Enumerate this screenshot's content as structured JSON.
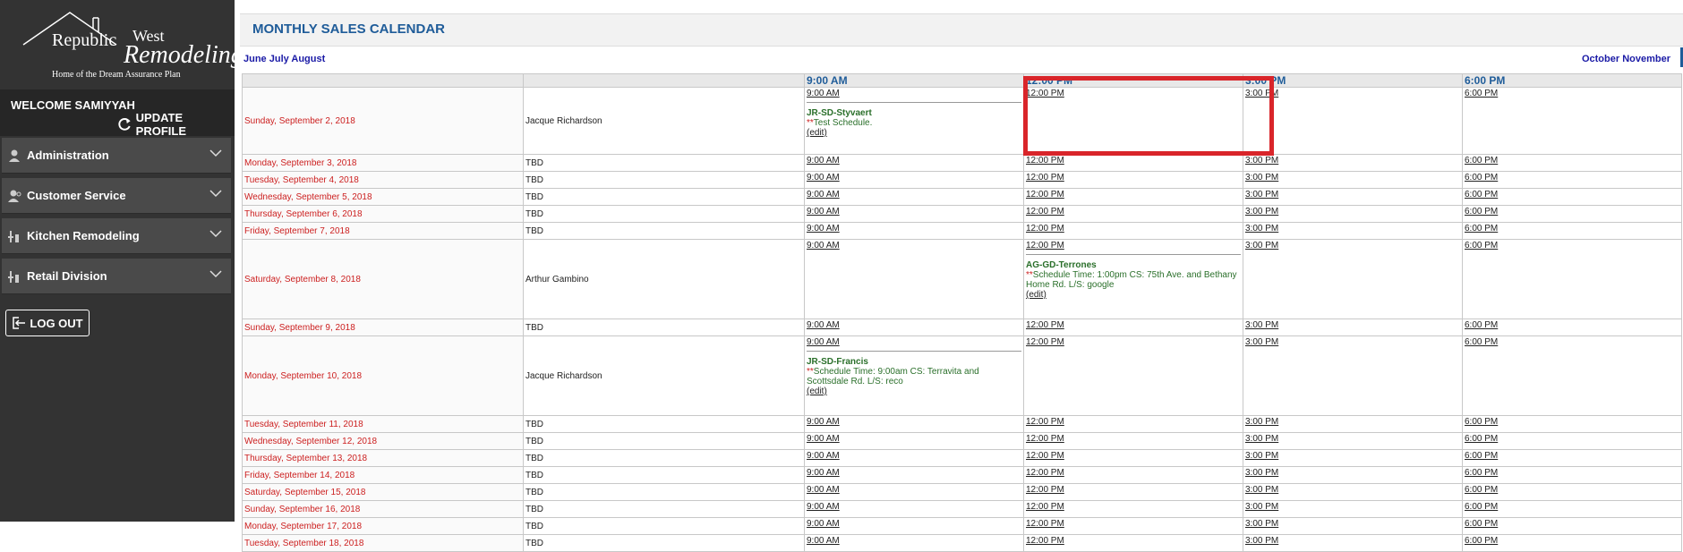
{
  "logo": {
    "line1": "Republic",
    "line2": "West",
    "line3": "Remodeling",
    "tagline": "Home of the Dream Assurance Plan"
  },
  "welcome": "WELCOME SAMIYYAH",
  "update_profile": "UPDATE PROFILE",
  "menu": [
    {
      "label": "Administration",
      "icon": "user-icon"
    },
    {
      "label": "Customer Service",
      "icon": "customer-service-icon"
    },
    {
      "label": "Kitchen Remodeling",
      "icon": "tools-icon"
    },
    {
      "label": "Retail Division",
      "icon": "tools-icon"
    }
  ],
  "logout": "LOG OUT",
  "page_title": "MONTHLY SALES CALENDAR",
  "nav_prev": "June July August",
  "nav_next": "October November",
  "time_headers": [
    "9:00 AM",
    "12:00 PM",
    "3:00 PM",
    "6:00 PM"
  ],
  "rows": [
    {
      "date": "Sunday, September 2, 2018",
      "rep": "Jacque Richardson",
      "slots": [
        "9:00 AM",
        "12:00 PM",
        "3:00 PM",
        "6:00 PM"
      ],
      "appt": {
        "code": "JR-SD-Styvaert",
        "note": "Test Schedule.",
        "edit": "(edit)"
      }
    },
    {
      "date": "Monday, September 3, 2018",
      "rep": "TBD",
      "slots": [
        "9:00 AM",
        "12:00 PM",
        "3:00 PM",
        "6:00 PM"
      ]
    },
    {
      "date": "Tuesday, September 4, 2018",
      "rep": "TBD",
      "slots": [
        "9:00 AM",
        "12:00 PM",
        "3:00 PM",
        "6:00 PM"
      ]
    },
    {
      "date": "Wednesday, September 5, 2018",
      "rep": "TBD",
      "slots": [
        "9:00 AM",
        "12:00 PM",
        "3:00 PM",
        "6:00 PM"
      ]
    },
    {
      "date": "Thursday, September 6, 2018",
      "rep": "TBD",
      "slots": [
        "9:00 AM",
        "12:00 PM",
        "3:00 PM",
        "6:00 PM"
      ]
    },
    {
      "date": "Friday, September 7, 2018",
      "rep": "TBD",
      "slots": [
        "9:00 AM",
        "12:00 PM",
        "3:00 PM",
        "6:00 PM"
      ]
    },
    {
      "date": "Saturday, September 8, 2018",
      "rep": "Arthur Gambino",
      "slots": [
        "9:00 AM",
        "12:00 PM",
        "3:00 PM",
        "6:00 PM"
      ],
      "appt": {
        "code": "AG-GD-Terrones",
        "note": "Schedule Time: 1:00pm CS: 75th Ave. and Bethany Home Rd. L/S: google",
        "edit": "(edit)"
      }
    },
    {
      "date": "Sunday, September 9, 2018",
      "rep": "TBD",
      "slots": [
        "9:00 AM",
        "12:00 PM",
        "3:00 PM",
        "6:00 PM"
      ]
    },
    {
      "date": "Monday, September 10, 2018",
      "rep": "Jacque Richardson",
      "slots": [
        "9:00 AM",
        "12:00 PM",
        "3:00 PM",
        "6:00 PM"
      ],
      "appt": {
        "code": "JR-SD-Francis",
        "note": "Schedule Time: 9:00am CS: Terravita and Scottsdale Rd. L/S: reco",
        "edit": "(edit)"
      }
    },
    {
      "date": "Tuesday, September 11, 2018",
      "rep": "TBD",
      "slots": [
        "9:00 AM",
        "12:00 PM",
        "3:00 PM",
        "6:00 PM"
      ]
    },
    {
      "date": "Wednesday, September 12, 2018",
      "rep": "TBD",
      "slots": [
        "9:00 AM",
        "12:00 PM",
        "3:00 PM",
        "6:00 PM"
      ]
    },
    {
      "date": "Thursday, September 13, 2018",
      "rep": "TBD",
      "slots": [
        "9:00 AM",
        "12:00 PM",
        "3:00 PM",
        "6:00 PM"
      ]
    },
    {
      "date": "Friday, September 14, 2018",
      "rep": "TBD",
      "slots": [
        "9:00 AM",
        "12:00 PM",
        "3:00 PM",
        "6:00 PM"
      ]
    },
    {
      "date": "Saturday, September 15, 2018",
      "rep": "TBD",
      "slots": [
        "9:00 AM",
        "12:00 PM",
        "3:00 PM",
        "6:00 PM"
      ]
    },
    {
      "date": "Sunday, September 16, 2018",
      "rep": "TBD",
      "slots": [
        "9:00 AM",
        "12:00 PM",
        "3:00 PM",
        "6:00 PM"
      ]
    },
    {
      "date": "Monday, September 17, 2018",
      "rep": "TBD",
      "slots": [
        "9:00 AM",
        "12:00 PM",
        "3:00 PM",
        "6:00 PM"
      ]
    },
    {
      "date": "Tuesday, September 18, 2018",
      "rep": "TBD",
      "slots": [
        "9:00 AM",
        "12:00 PM",
        "3:00 PM",
        "6:00 PM"
      ]
    }
  ]
}
